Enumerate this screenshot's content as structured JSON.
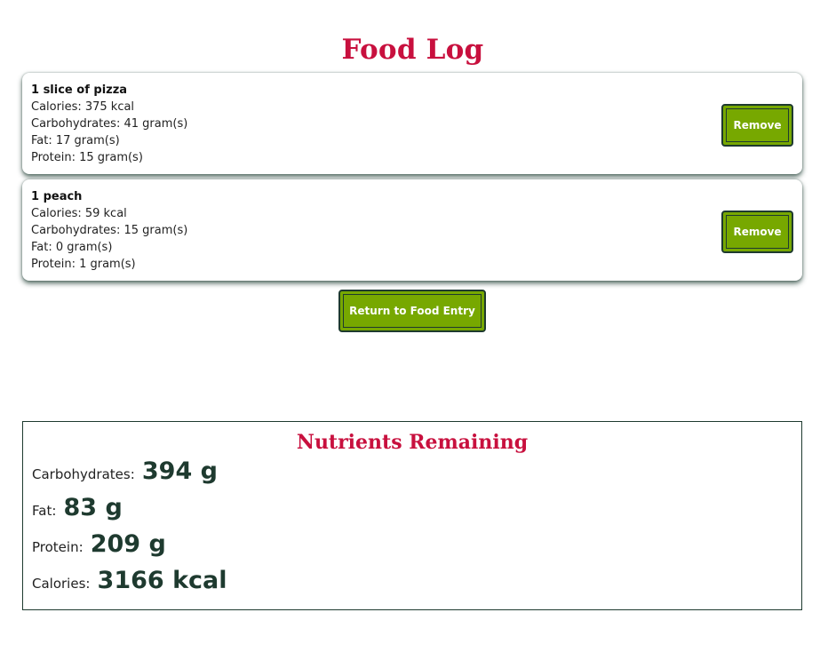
{
  "header": {
    "title": "Food Log"
  },
  "food_log": {
    "items": [
      {
        "name": "1 slice of pizza",
        "calories": "Calories: 375 kcal",
        "carbohydrates": "Carbohydrates: 41 gram(s)",
        "fat": "Fat: 17 gram(s)",
        "protein": "Protein: 15 gram(s)",
        "remove_label": "Remove"
      },
      {
        "name": "1 peach",
        "calories": "Calories: 59 kcal",
        "carbohydrates": "Carbohydrates: 15 gram(s)",
        "fat": "Fat: 0 gram(s)",
        "protein": "Protein: 1 gram(s)",
        "remove_label": "Remove"
      }
    ],
    "return_label": "Return to Food Entry"
  },
  "nutrients": {
    "title": "Nutrients Remaining",
    "rows": [
      {
        "label": "Carbohydrates:",
        "value": "394 g"
      },
      {
        "label": "Fat:",
        "value": "83 g"
      },
      {
        "label": "Protein:",
        "value": "209 g"
      },
      {
        "label": "Calories:",
        "value": "3166 kcal"
      }
    ]
  },
  "colors": {
    "title": "#c8103e",
    "button": "#77a800",
    "border": "#1e3a2f"
  }
}
